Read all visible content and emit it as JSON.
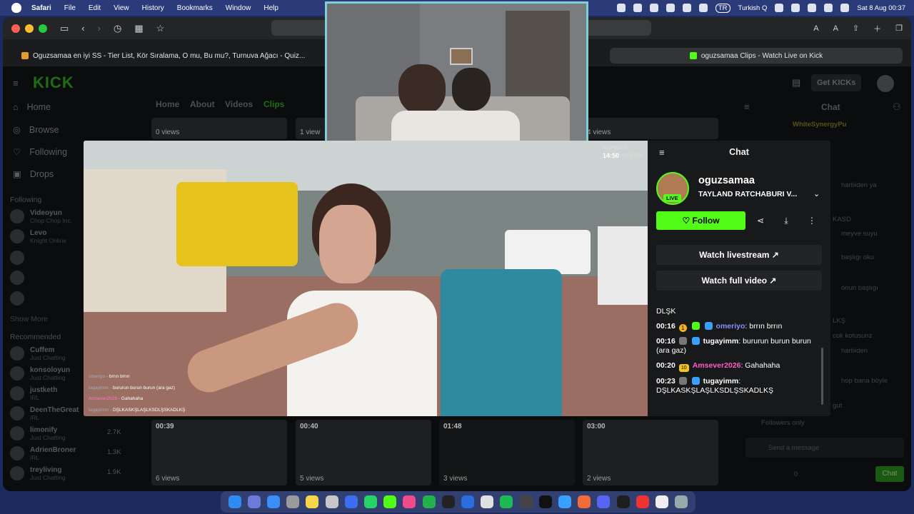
{
  "menubar": {
    "app": "Safari",
    "items": [
      "File",
      "Edit",
      "View",
      "History",
      "Bookmarks",
      "Window",
      "Help"
    ],
    "input_source": "TR",
    "input_name": "Turkish Q",
    "datetime": "Sat 8 Aug  00:37"
  },
  "toolbar": {
    "font_small": "A",
    "font_large": "A"
  },
  "tabs": [
    {
      "title": "Oguzsamaa en iyi SS - Tier List, Kör Sıralama, O mu, Bu mu?, Turnuva Ağacı - Quiz..."
    },
    {
      "title": "oguzsamaa Clips - Watch Live on Kick"
    }
  ],
  "kick": {
    "logo": "KICK",
    "get_kicks": "Get KICKs",
    "nav": [
      {
        "label": "Home",
        "icon": "home-icon"
      },
      {
        "label": "Browse",
        "icon": "compass-icon"
      },
      {
        "label": "Following",
        "icon": "heart-icon"
      },
      {
        "label": "Drops",
        "icon": "gift-icon"
      }
    ],
    "following_title": "Following",
    "following": [
      {
        "name": "Videoyun",
        "sub": "Chop Chop Inc."
      },
      {
        "name": "Levo",
        "sub": "Knight Online"
      }
    ],
    "show_more": "Show More",
    "recommended_title": "Recommended",
    "recommended": [
      {
        "name": "Cuffem",
        "sub": "Just Chatting",
        "viewers": ""
      },
      {
        "name": "konsoloyun",
        "sub": "Just Chatting",
        "viewers": ""
      },
      {
        "name": "justketh",
        "sub": "IRL",
        "viewers": ""
      },
      {
        "name": "DeenTheGreat",
        "sub": "IRL",
        "viewers": ""
      },
      {
        "name": "limonify",
        "sub": "Just Chatting",
        "viewers": "2.7K"
      },
      {
        "name": "AdrienBroner",
        "sub": "IRL",
        "viewers": "1.3K"
      },
      {
        "name": "treyliving",
        "sub": "Just Chatting",
        "viewers": "1.9K"
      }
    ],
    "subnav": [
      "Home",
      "About",
      "Videos",
      "Clips"
    ],
    "top_clips": [
      {
        "views": "0 views"
      },
      {
        "views": "1 view"
      },
      {
        "views": "4 views"
      }
    ],
    "bottom_clips": [
      {
        "duration": "00:39",
        "views": "6 views"
      },
      {
        "duration": "00:40",
        "views": "5 views"
      },
      {
        "duration": "01:48",
        "views": "3 views"
      },
      {
        "duration": "03:00",
        "views": "2 views"
      }
    ],
    "bg_chat": {
      "title": "Chat",
      "highlight_user": "WhiteSynergyPu",
      "lines": [
        "harbiden ya",
        "KASD",
        "meyve suyu",
        "başlıgı oku",
        "onun başlıgı",
        "LKŞ",
        "cok kotusunz",
        "harbiden",
        "hop bana böyle",
        "gut"
      ],
      "followers_only": "Followers only",
      "placeholder": "Send a message",
      "count": "0",
      "chat_btn": "Chat"
    }
  },
  "overlay_clock": {
    "time": "14:50",
    "date": "04.08.2024",
    "label": "KeyPalace"
  },
  "overlay_chat": [
    {
      "user": "omeriyo",
      "text": "brrın brrın"
    },
    {
      "user": "tugayimm",
      "text": "bururun burun burun (ara gaz)"
    },
    {
      "user": "Amsever2026",
      "text": "Gahahaha"
    },
    {
      "user": "tugayimm",
      "text": "DŞLKASKŞLAŞLKSDLŞSKADLKŞ"
    }
  ],
  "modal": {
    "title": "Chat",
    "channel": "oguzsamaa",
    "stream_title": "TAYLAND RATCHABURI V...",
    "live": "LIVE",
    "follow": "Follow",
    "watch_livestream": "Watch livestream",
    "watch_full_video": "Watch full video",
    "top_fragment": "DLŞK",
    "messages": [
      {
        "time": "00:16",
        "user": "omeriyo",
        "color": "#8a8dff",
        "text": "brrın brrın",
        "badge_num": "1",
        "badge_color": "#f3b41b"
      },
      {
        "time": "00:16",
        "user": "tugayimm",
        "color": "#ffffff",
        "text": "bururun burun burun (ara gaz)",
        "badge_num": "",
        "badge_color": "#3aa0ff"
      },
      {
        "time": "00:20",
        "user": "Amsever2026",
        "color": "#ff5cc8",
        "text": "Gahahaha",
        "badge_num": "10",
        "badge_color": "#f3c51b"
      },
      {
        "time": "00:23",
        "user": "tugayimm",
        "color": "#ffffff",
        "text": "DŞLKASKŞLAŞLKSDLŞSKADLKŞ",
        "badge_num": "",
        "badge_color": "#3aa0ff"
      }
    ]
  },
  "colors": {
    "accent": "#53fc18"
  }
}
